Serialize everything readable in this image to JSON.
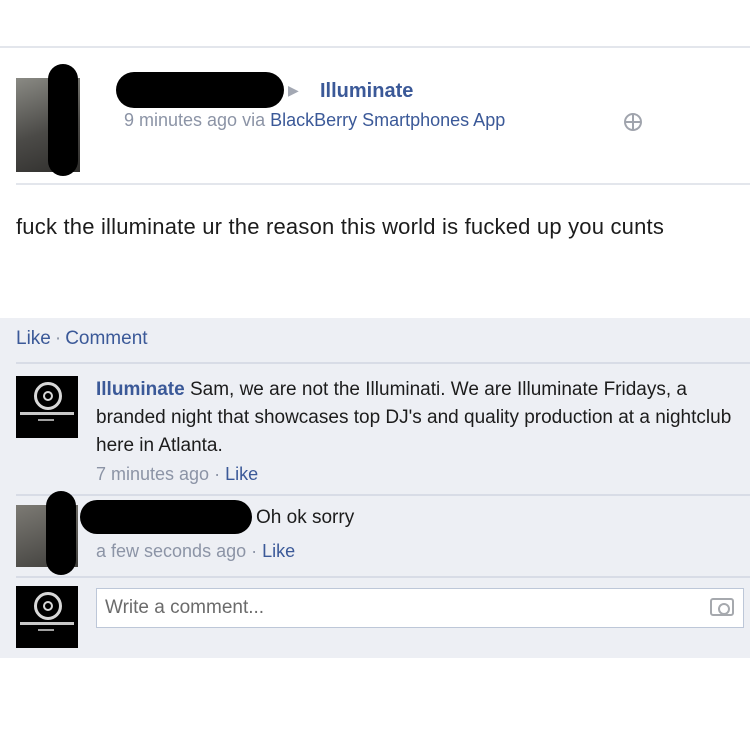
{
  "post": {
    "target": "Illuminate",
    "meta_prefix": "9 minutes ago via ",
    "meta_app": "BlackBerry Smartphones App",
    "text": "fuck the illuminate ur the reason this world is fucked up you cunts"
  },
  "actions": {
    "like": "Like",
    "separator": "·",
    "comment": "Comment"
  },
  "comments": [
    {
      "author": "Illuminate",
      "text": " Sam, we are not the Illuminati. We are Illuminate Fridays, a branded night that showcases top DJ's and quality production at a nightclub here in Atlanta.",
      "time": "7 minutes ago",
      "like": "Like"
    },
    {
      "text": "Oh ok sorry",
      "time": "a few seconds ago",
      "like": "Like"
    }
  ],
  "composer": {
    "placeholder": "Write a comment..."
  },
  "icons": {
    "arrow": "right-triangle-icon",
    "audience": "globe-icon",
    "attach": "camera-icon"
  },
  "colors": {
    "link": "#3b5998",
    "meta": "#8c94a6",
    "comments_bg": "#edeff4"
  }
}
